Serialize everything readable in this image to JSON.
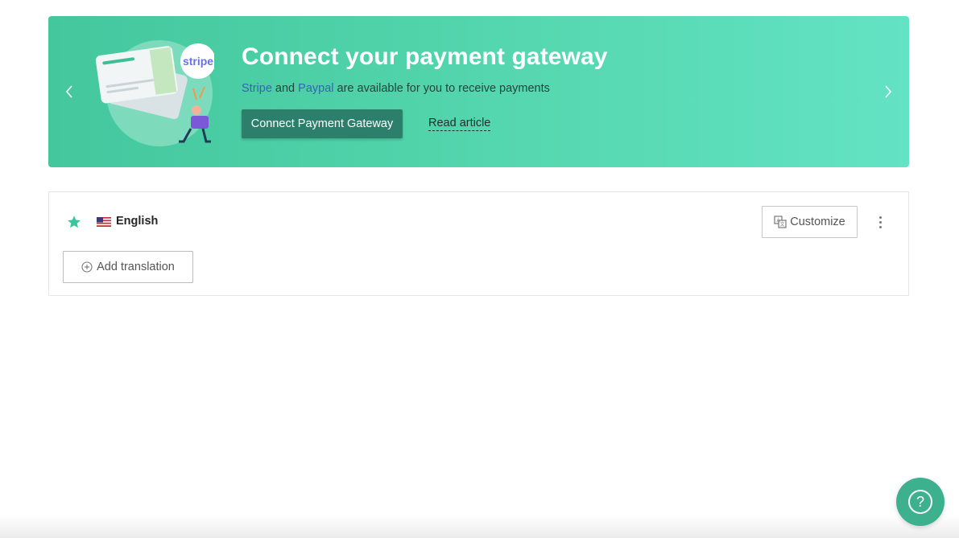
{
  "banner": {
    "title": "Connect your payment gateway",
    "subtitle": {
      "stripe_link": "Stripe",
      "and": "and",
      "paypal_link": "Paypal",
      "rest": "are available for you to receive payments"
    },
    "connect_button": "Connect Payment Gateway",
    "read_article": "Read article",
    "illustration_badge": "stripe",
    "colors": {
      "gradient_start": "#44c79d",
      "gradient_end": "#63e3c3",
      "button": "#2c806b",
      "link": "#3465b0"
    },
    "icons": [
      "chevron-left-icon",
      "chevron-right-icon"
    ]
  },
  "languages": [
    {
      "name": "English",
      "default": true,
      "flag": "us-flag-icon",
      "customize_label": "Customize"
    }
  ],
  "add_translation_label": "Add translation",
  "help": {
    "label": "?",
    "color": "#3db08d"
  }
}
